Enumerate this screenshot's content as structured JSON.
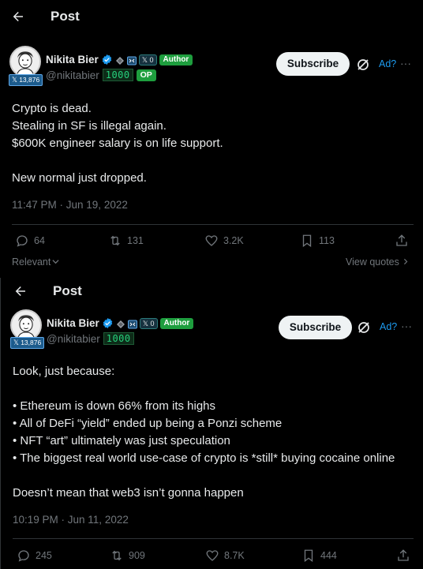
{
  "posts": [
    {
      "header_title": "Post",
      "author": {
        "name": "Nikita Bier",
        "handle": "@nikitabier",
        "follower_badge": "𝕏 13,876",
        "x_badge": "𝕏 0",
        "author_tag": "Author",
        "score_tag": "1000",
        "op_tag": "OP"
      },
      "subscribe_label": "Subscribe",
      "ad_label": "Ad?",
      "more_label": "···",
      "body_lines": [
        "Crypto is dead.",
        "Stealing in SF is illegal again.",
        "$600K engineer salary is on life support.",
        "",
        "New normal just dropped."
      ],
      "timestamp": "11:47 PM · Jun 19, 2022",
      "actions": {
        "replies": "64",
        "reposts": "131",
        "likes": "3.2K",
        "bookmarks": "113"
      },
      "sort_label": "Relevant",
      "view_quotes_label": "View quotes"
    },
    {
      "header_title": "Post",
      "author": {
        "name": "Nikita Bier",
        "handle": "@nikitabier",
        "follower_badge": "𝕏 13,876",
        "x_badge": "𝕏 0",
        "author_tag": "Author",
        "score_tag": "1000"
      },
      "subscribe_label": "Subscribe",
      "ad_label": "Ad?",
      "more_label": "···",
      "body_lines": [
        "Look, just because:",
        "",
        "• Ethereum is down 66% from its highs",
        "• All of DeFi “yield” ended up being a Ponzi scheme",
        "• NFT “art” ultimately was just speculation",
        "• The biggest real world use-case of crypto is *still* buying cocaine online",
        "",
        "Doesn’t mean that web3 isn’t gonna happen"
      ],
      "timestamp": "10:19 PM · Jun 11, 2022",
      "actions": {
        "replies": "245",
        "reposts": "909",
        "likes": "8.7K",
        "bookmarks": "444"
      }
    }
  ],
  "colors": {
    "background": "#000000",
    "text": "#e7e9ea",
    "muted": "#71767b",
    "accent": "#1d9bf0",
    "green_tag": "#1e9e3e",
    "divider": "#2f3336"
  }
}
